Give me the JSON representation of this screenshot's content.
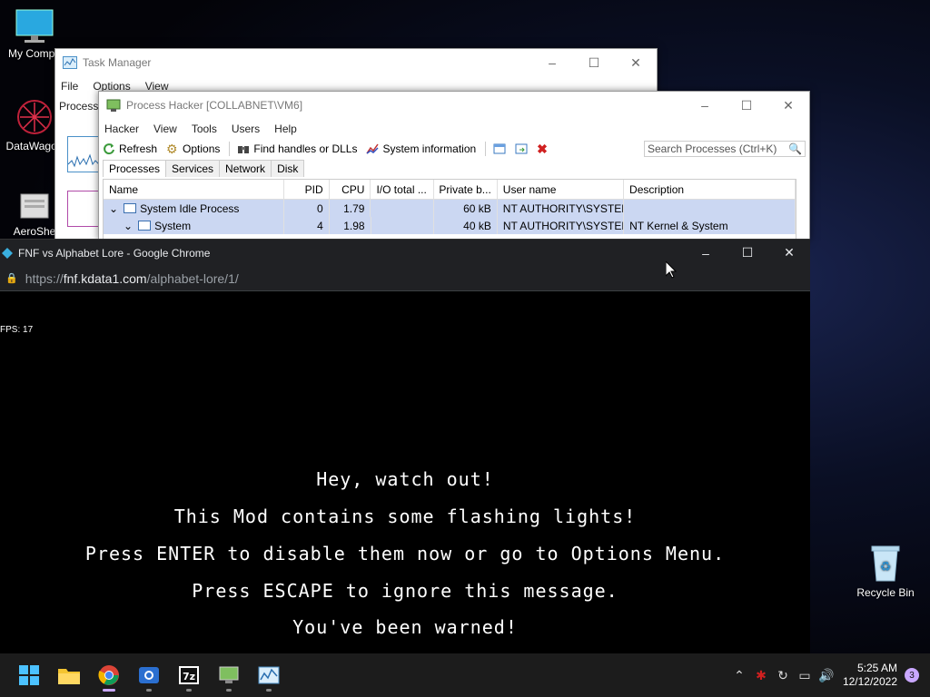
{
  "desktop": {
    "icons": [
      {
        "label": "My Compu"
      },
      {
        "label": "DataWagon"
      },
      {
        "label": "AeroShe"
      },
      {
        "label": "Recycle Bin"
      }
    ]
  },
  "task_manager": {
    "title": "Task Manager",
    "menu": [
      "File",
      "Options",
      "View"
    ],
    "tab": "Process"
  },
  "process_hacker": {
    "title": "Process Hacker [COLLABNET\\VM6]",
    "menu": [
      "Hacker",
      "View",
      "Tools",
      "Users",
      "Help"
    ],
    "toolbar": {
      "refresh": "Refresh",
      "options": "Options",
      "find_handles": "Find handles or DLLs",
      "system_info": "System information"
    },
    "search_placeholder": "Search Processes (Ctrl+K)",
    "tabs": [
      "Processes",
      "Services",
      "Network",
      "Disk"
    ],
    "columns": [
      "Name",
      "PID",
      "CPU",
      "I/O total ...",
      "Private b...",
      "User name",
      "Description"
    ],
    "rows": [
      {
        "name": "System Idle Process",
        "pid": "0",
        "cpu": "1.79",
        "io": "",
        "private": "60 kB",
        "user": "NT AUTHORITY\\SYSTEM",
        "desc": ""
      },
      {
        "name": "System",
        "pid": "4",
        "cpu": "1.98",
        "io": "",
        "private": "40 kB",
        "user": "NT AUTHORITY\\SYSTEM",
        "desc": "NT Kernel & System"
      }
    ]
  },
  "chrome": {
    "title": "FNF vs Alphabet Lore - Google Chrome",
    "url_prefix": "https://",
    "url_host": "fnf.kdata1.com",
    "url_path": "/alphabet-lore/1/",
    "fps": "FPS: 17",
    "messages": [
      "Hey, watch out!",
      "This Mod contains some flashing lights!",
      "Press ENTER to disable them now or go to Options Menu.",
      "Press ESCAPE to ignore this message.",
      "You've been warned!"
    ]
  },
  "taskbar": {
    "apps": [
      "start",
      "file-explorer",
      "chrome",
      "camera-app",
      "7zip",
      "process-hacker",
      "task-manager"
    ],
    "time": "5:25 AM",
    "date": "12/12/2022",
    "notifications": "3"
  }
}
